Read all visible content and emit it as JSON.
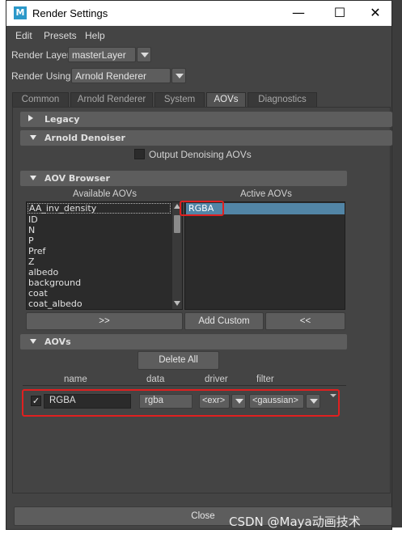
{
  "window": {
    "title": "Render Settings",
    "icon_letter": "M",
    "minimize": "—",
    "maximize": "☐",
    "close": "✕"
  },
  "menu": [
    "Edit",
    "Presets",
    "Help"
  ],
  "render_layer": {
    "label": "Render Layer",
    "value": "masterLayer"
  },
  "render_using": {
    "label": "Render Using",
    "value": "Arnold Renderer"
  },
  "tabs": [
    {
      "label": "Common",
      "active": false
    },
    {
      "label": "Arnold Renderer",
      "active": false
    },
    {
      "label": "System",
      "active": false
    },
    {
      "label": "AOVs",
      "active": true
    },
    {
      "label": "Diagnostics",
      "active": false
    }
  ],
  "sections": {
    "legacy": "Legacy",
    "denoiser": "Arnold Denoiser",
    "denoiser_checkbox": "Output Denoising AOVs",
    "aov_browser": "AOV Browser",
    "aovs": "AOVs"
  },
  "browser": {
    "available_title": "Available AOVs",
    "active_title": "Active AOVs",
    "available": [
      "AA_inv_density",
      "ID",
      "N",
      "P",
      "Pref",
      "Z",
      "albedo",
      "background",
      "coat",
      "coat_albedo"
    ],
    "active": [
      "RGBA"
    ],
    "add_button": ">>",
    "add_custom_button": "Add Custom",
    "remove_button": "<<"
  },
  "aov_table": {
    "delete_all": "Delete All",
    "columns": {
      "name": "name",
      "data": "data",
      "driver": "driver",
      "filter": "filter"
    },
    "rows": [
      {
        "enabled": true,
        "name": "RGBA",
        "data": "rgba",
        "driver": "<exr>",
        "filter": "<gaussian>"
      }
    ]
  },
  "footer": {
    "close": "Close"
  },
  "watermark": "CSDN @Maya动画技术",
  "colors": {
    "highlight": "#e02020",
    "selection": "#5285a6"
  }
}
